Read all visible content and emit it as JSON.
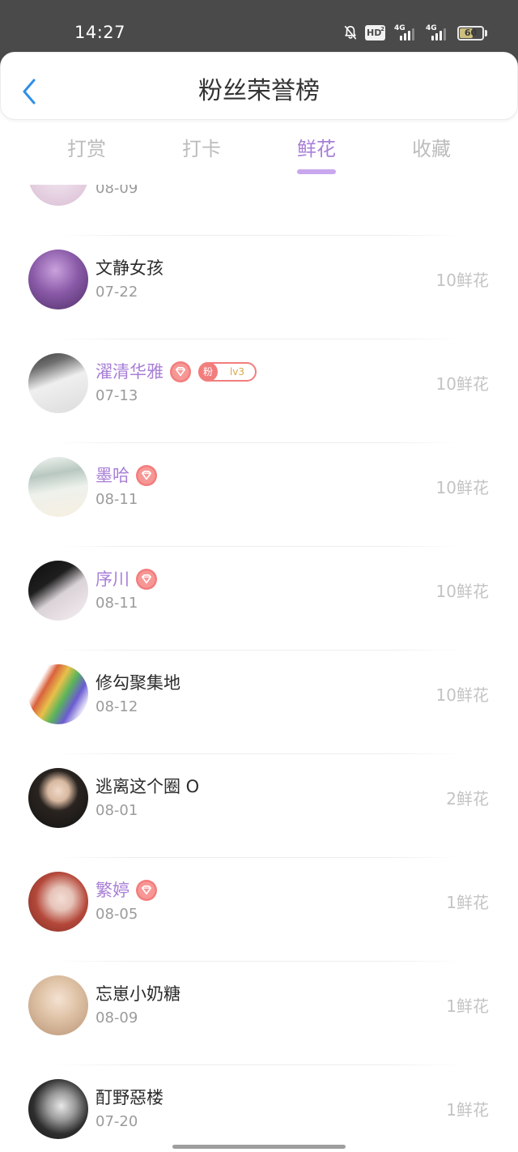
{
  "status_bar": {
    "time": "14:27",
    "notification_icon": "bell-off-icon",
    "hd": {
      "label": "HD",
      "sub": "2"
    },
    "signals": [
      {
        "label": "4G",
        "level": 3
      },
      {
        "label": "4G",
        "level": 3
      }
    ],
    "battery": {
      "level": "60"
    }
  },
  "header": {
    "back_icon": "chevron-left-icon",
    "title": "粉丝荣誉榜"
  },
  "tabs": {
    "items": [
      {
        "label": "打赏"
      },
      {
        "label": "打卡"
      },
      {
        "label": "鲜花"
      },
      {
        "label": "收藏"
      }
    ],
    "active_index": 2
  },
  "list": {
    "rows": [
      {
        "date": "08-09"
      },
      {
        "name": "文静女孩",
        "date": "07-22",
        "count": "10鲜花"
      },
      {
        "name": "濯清华雅",
        "name_color": "#a87fd6",
        "badges": [
          "diamond-heart-icon"
        ],
        "fan_badge": {
          "label": "粉",
          "level": "lv3"
        },
        "date": "07-13",
        "count": "10鲜花"
      },
      {
        "name": "墨哈",
        "name_color": "#a87fd6",
        "badges": [
          "diamond-heart-icon"
        ],
        "date": "08-11",
        "count": "10鲜花"
      },
      {
        "name": "序川",
        "name_color": "#a87fd6",
        "badges": [
          "diamond-heart-icon"
        ],
        "date": "08-11",
        "count": "10鲜花"
      },
      {
        "name": "修勾聚集地",
        "date": "08-12",
        "count": "10鲜花"
      },
      {
        "name": "逃离这个圈 O",
        "date": "08-01",
        "count": "2鲜花"
      },
      {
        "name": "繁婷",
        "name_color": "#a87fd6",
        "badges": [
          "diamond-heart-icon"
        ],
        "date": "08-05",
        "count": "1鲜花"
      },
      {
        "name": "忘崽小奶糖",
        "date": "08-09",
        "count": "1鲜花"
      },
      {
        "name": "酊野惡楼",
        "date": "07-20",
        "count": "1鲜花"
      }
    ]
  },
  "theme": {
    "accent": "#a87fd6",
    "tab_indicator": "#c9a7ef",
    "back_arrow": "#2f8fe6",
    "badge_red": "#f27d7d",
    "fan_level_text": "#d7a84c",
    "status_bar_bg": "#4a4a4a"
  }
}
